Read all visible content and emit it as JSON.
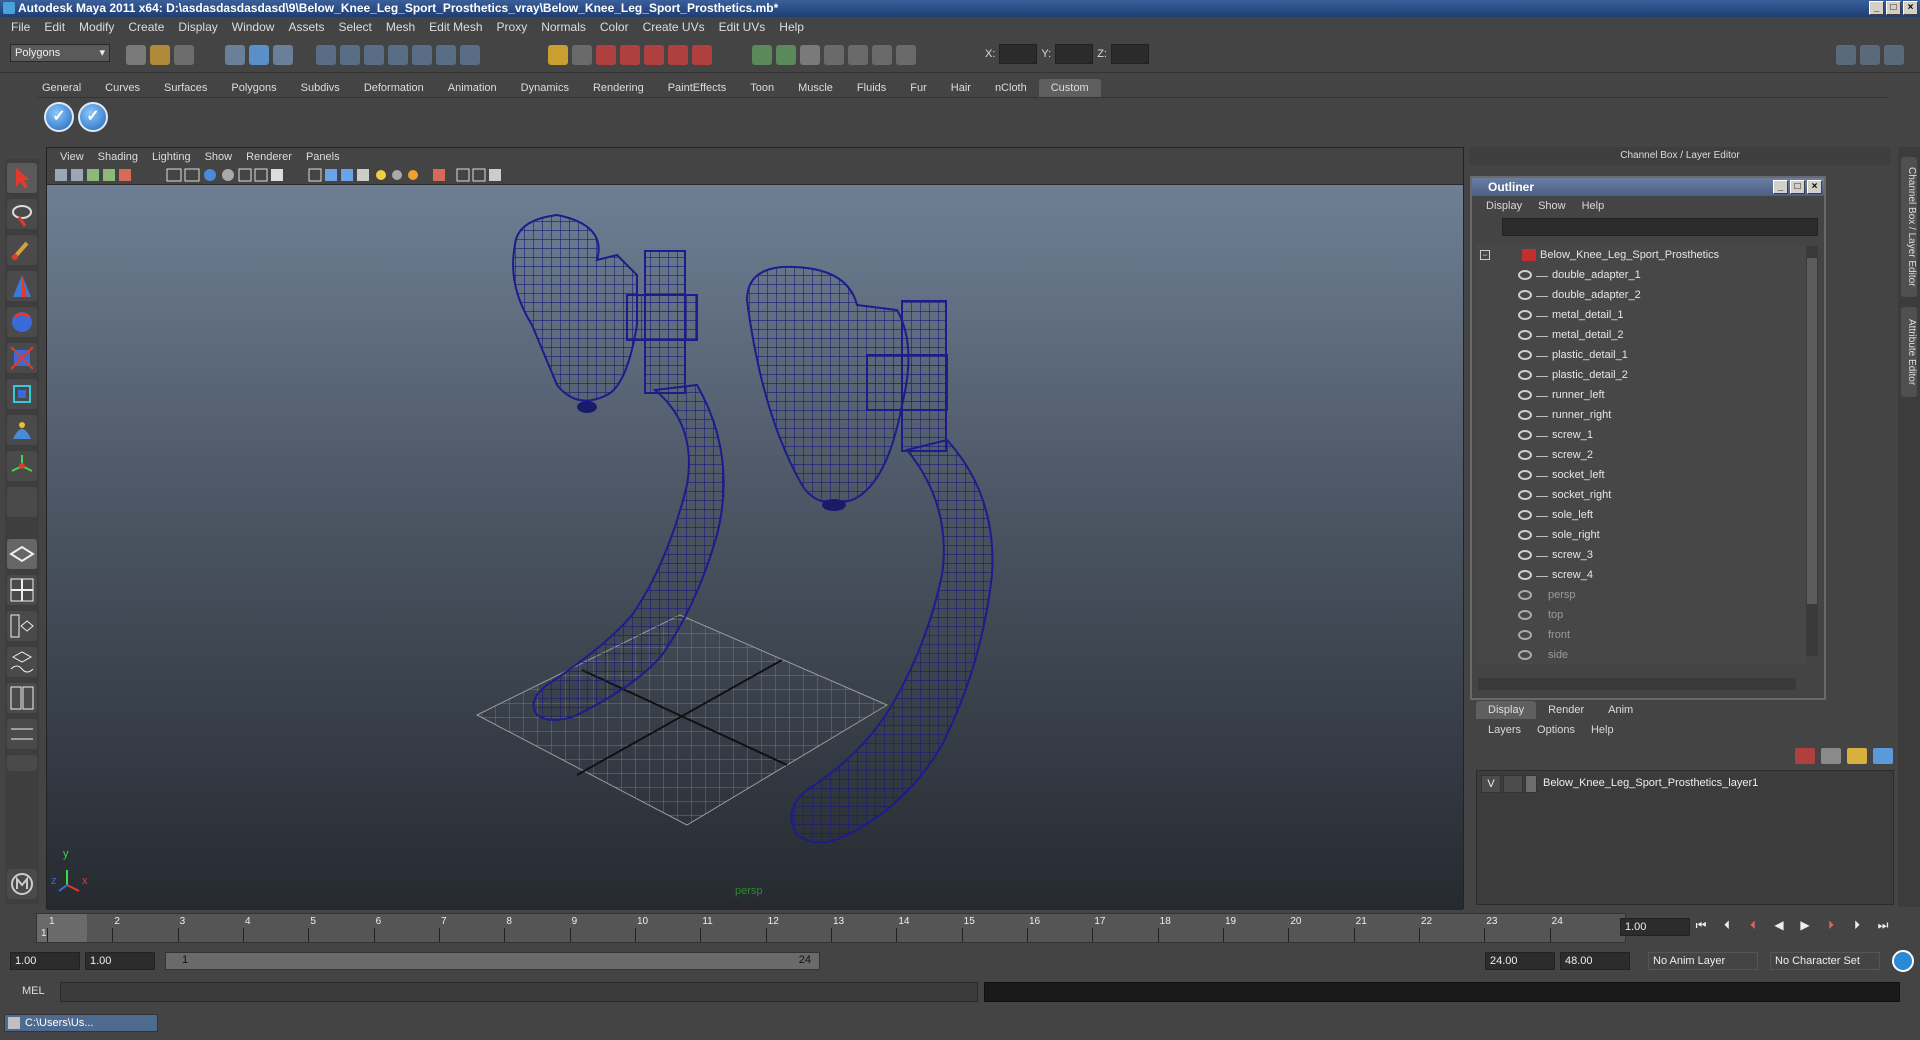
{
  "window": {
    "title": "Autodesk Maya 2011 x64: D:\\asdasdasdasdasd\\9\\Below_Knee_Leg_Sport_Prosthetics_vray\\Below_Knee_Leg_Sport_Prosthetics.mb*"
  },
  "menubar": [
    "File",
    "Edit",
    "Modify",
    "Create",
    "Display",
    "Window",
    "Assets",
    "Select",
    "Mesh",
    "Edit Mesh",
    "Proxy",
    "Normals",
    "Color",
    "Create UVs",
    "Edit UVs",
    "Help"
  ],
  "status": {
    "mode": "Polygons",
    "x_label": "X:",
    "y_label": "Y:",
    "z_label": "Z:"
  },
  "shelf_tabs": [
    "General",
    "Curves",
    "Surfaces",
    "Polygons",
    "Subdivs",
    "Deformation",
    "Animation",
    "Dynamics",
    "Rendering",
    "PaintEffects",
    "Toon",
    "Muscle",
    "Fluids",
    "Fur",
    "Hair",
    "nCloth",
    "Custom"
  ],
  "shelf_active": "Custom",
  "viewport": {
    "menu": [
      "View",
      "Shading",
      "Lighting",
      "Show",
      "Renderer",
      "Panels"
    ],
    "camera_label": "persp",
    "axis_y": "y",
    "axis_x": "x",
    "axis_z": "z"
  },
  "channel_box": {
    "header": "Channel Box / Layer Editor"
  },
  "outliner": {
    "title": "Outliner",
    "menu": [
      "Display",
      "Show",
      "Help"
    ],
    "root": "Below_Knee_Leg_Sport_Prosthetics",
    "children": [
      "double_adapter_1",
      "double_adapter_2",
      "metal_detail_1",
      "metal_detail_2",
      "plastic_detail_1",
      "plastic_detail_2",
      "runner_left",
      "runner_right",
      "screw_1",
      "screw_2",
      "socket_left",
      "socket_right",
      "sole_left",
      "sole_right",
      "screw_3",
      "screw_4"
    ],
    "cameras": [
      "persp",
      "top",
      "front",
      "side"
    ]
  },
  "layer_editor": {
    "tabs": [
      "Display",
      "Render",
      "Anim"
    ],
    "active_tab": "Display",
    "menu": [
      "Layers",
      "Options",
      "Help"
    ],
    "layers": [
      {
        "visible": "V",
        "name": "Below_Knee_Leg_Sport_Prosthetics_layer1"
      }
    ]
  },
  "side_tabs": [
    "Channel Box / Layer Editor",
    "Attribute Editor"
  ],
  "timeline": {
    "ticks": [
      "1",
      "2",
      "3",
      "4",
      "5",
      "6",
      "7",
      "8",
      "9",
      "10",
      "11",
      "12",
      "13",
      "14",
      "15",
      "16",
      "17",
      "18",
      "19",
      "20",
      "21",
      "22",
      "23",
      "24"
    ],
    "current_frame": "1",
    "current_time": "1.00"
  },
  "range": {
    "start": "1.00",
    "playback_start": "1.00",
    "slider_start": "1",
    "slider_end": "24",
    "playback_end": "24.00",
    "end": "48.00",
    "anim_layer": "No Anim Layer",
    "character_set": "No Character Set"
  },
  "command": {
    "label": "MEL"
  },
  "taskbar": {
    "item": "C:\\Users\\Us..."
  }
}
